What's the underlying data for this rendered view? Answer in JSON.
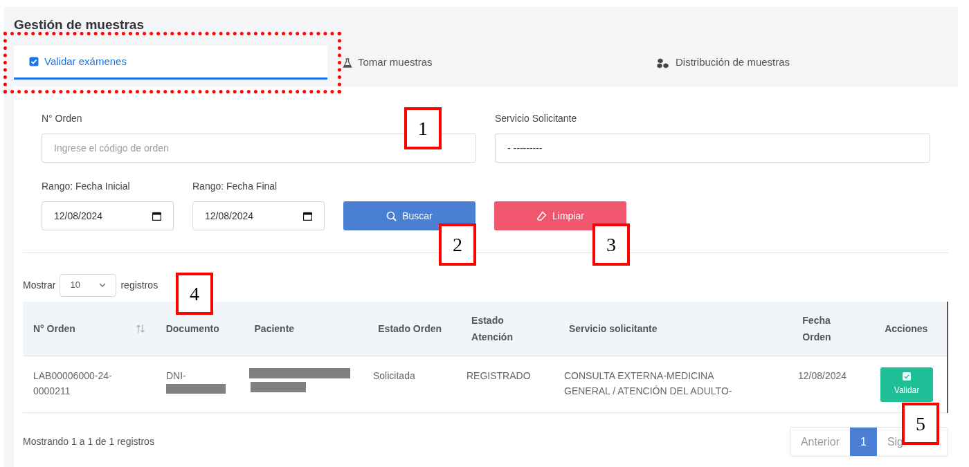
{
  "title": "Gestión de muestras",
  "tabs": [
    {
      "label": "Validar exámenes",
      "selected": true,
      "highlighted": true
    },
    {
      "label": "Tomar muestras",
      "selected": false,
      "highlighted": false
    },
    {
      "label": "Distribución de muestras",
      "selected": false,
      "highlighted": false
    }
  ],
  "filters": {
    "order": {
      "label": "N° Orden",
      "placeholder": "Ingrese el código de orden"
    },
    "service": {
      "label": "Servicio Solicitante",
      "value": "- ---------"
    },
    "date_from": {
      "label": "Rango: Fecha Inicial",
      "value": "12/08/2024"
    },
    "date_to": {
      "label": "Rango: Fecha Final",
      "value": "12/08/2024"
    }
  },
  "buttons": [
    {
      "label": "Buscar",
      "kind": "search"
    },
    {
      "label": "Limpiar",
      "kind": "clear"
    }
  ],
  "page_length": {
    "prefix": "Mostrar",
    "value": "10",
    "suffix": "registros"
  },
  "table": {
    "columns": [
      {
        "label": "N° Orden"
      },
      {
        "label": "Documento"
      },
      {
        "label": "Paciente"
      },
      {
        "label": "Estado Orden"
      },
      {
        "label": "Estado Atención"
      },
      {
        "label": "Servicio solicitante"
      },
      {
        "label": "Fecha Orden"
      },
      {
        "label": "Acciones"
      }
    ],
    "rows": [
      {
        "cells": [
          {
            "kind": "text",
            "text": "LAB00006000-24-0000211"
          },
          {
            "kind": "prefix_redacted",
            "text": "DNI-"
          },
          {
            "kind": "redacted"
          },
          {
            "kind": "text",
            "text": "Solicitada"
          },
          {
            "kind": "text",
            "text": "REGISTRADO"
          },
          {
            "kind": "text",
            "text": "CONSULTA EXTERNA-MEDICINA GENERAL / ATENCIÓN DEL ADULTO-"
          },
          {
            "kind": "text",
            "text": "12/08/2024"
          },
          {
            "kind": "button",
            "text": "Validar"
          }
        ]
      }
    ]
  },
  "summary": "Mostrando 1 a 1 de 1 registros",
  "pagination": [
    {
      "label": "Anterior",
      "selected": false
    },
    {
      "label": "1",
      "selected": true
    },
    {
      "label": "Sig",
      "selected": false
    }
  ],
  "annotations": [
    {
      "label": "1"
    },
    {
      "label": "2"
    },
    {
      "label": "3"
    },
    {
      "label": "4"
    },
    {
      "label": "5"
    }
  ]
}
